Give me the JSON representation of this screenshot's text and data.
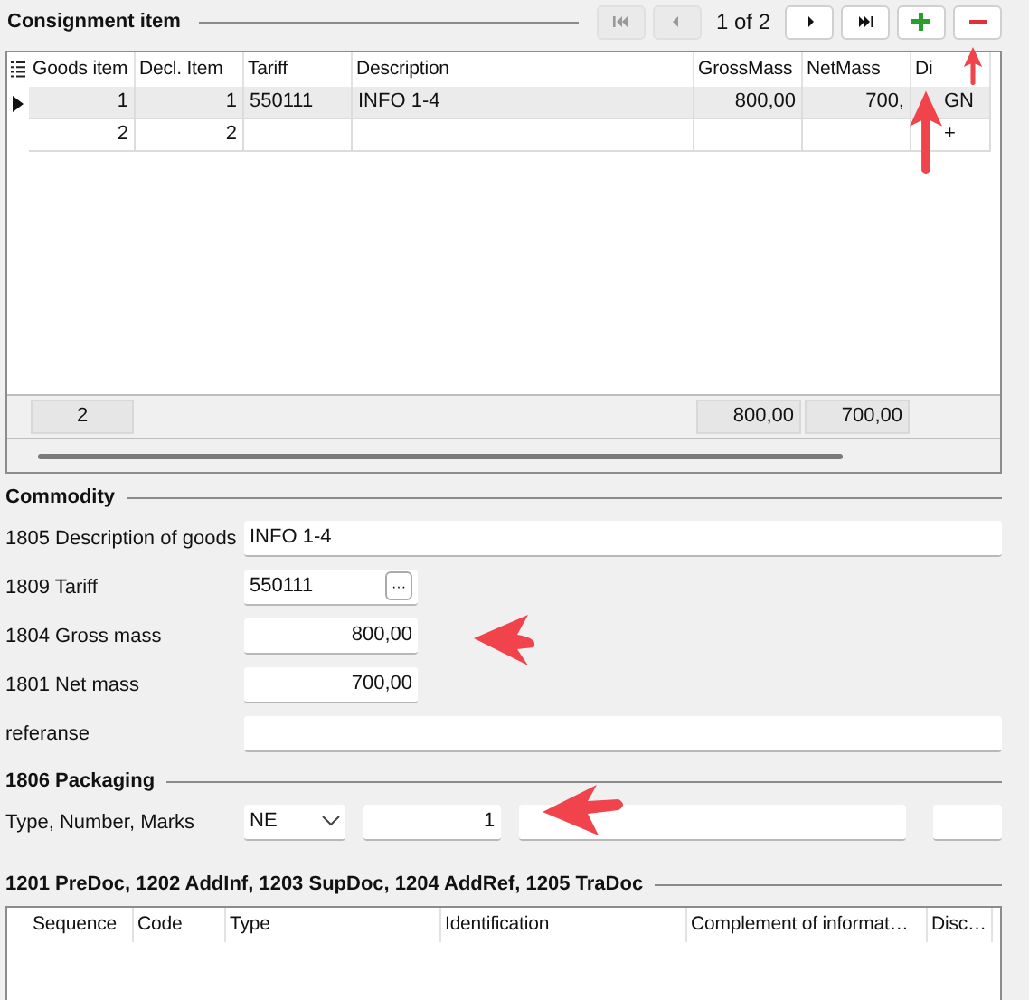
{
  "consignment": {
    "title": "Consignment item",
    "pager": "1 of 2",
    "nav_buttons": [
      {
        "kind": "first",
        "disabled": true
      },
      {
        "kind": "prev",
        "disabled": true
      },
      {
        "kind": "next",
        "disabled": false
      },
      {
        "kind": "last",
        "disabled": false
      },
      {
        "kind": "add",
        "disabled": false
      },
      {
        "kind": "remove",
        "disabled": false
      }
    ],
    "columns": [
      "Goods item",
      "Decl. Item",
      "Tariff",
      "Description",
      "GrossMass",
      "NetMass",
      "Di"
    ],
    "rows": [
      {
        "selected": true,
        "cells": [
          "1",
          "1",
          "550111",
          "INFO 1-4",
          "800,00",
          "700,",
          "GN"
        ]
      },
      {
        "selected": false,
        "cells": [
          "2",
          "2",
          "",
          "",
          "",
          "",
          "+"
        ]
      }
    ],
    "footer": {
      "goods_item": "2",
      "gross_mass": "800,00",
      "net_mass": "700,00"
    }
  },
  "commodity": {
    "title": "Commodity",
    "fields": [
      {
        "kind": "text",
        "label": "1805 Description of goods",
        "value": "INFO 1-4"
      },
      {
        "kind": "lookup",
        "label": "1809 Tariff",
        "value": "550111",
        "button": "···"
      },
      {
        "kind": "number",
        "label": "1804 Gross mass",
        "value": "800,00"
      },
      {
        "kind": "number",
        "label": "1801 Net mass",
        "value": "700,00"
      },
      {
        "kind": "text",
        "label": "referanse"
      }
    ]
  },
  "packaging": {
    "title": "1806 Packaging",
    "label": "Type, Number, Marks",
    "type": "NE",
    "number": "1"
  },
  "documents": {
    "title": "1201 PreDoc, 1202 AddInf,  1203 SupDoc, 1204 AddRef, 1205 TraDoc",
    "columns": [
      "Sequence",
      "Code",
      "Type",
      "Identification",
      "Complement of informat…",
      "Disc…"
    ]
  }
}
